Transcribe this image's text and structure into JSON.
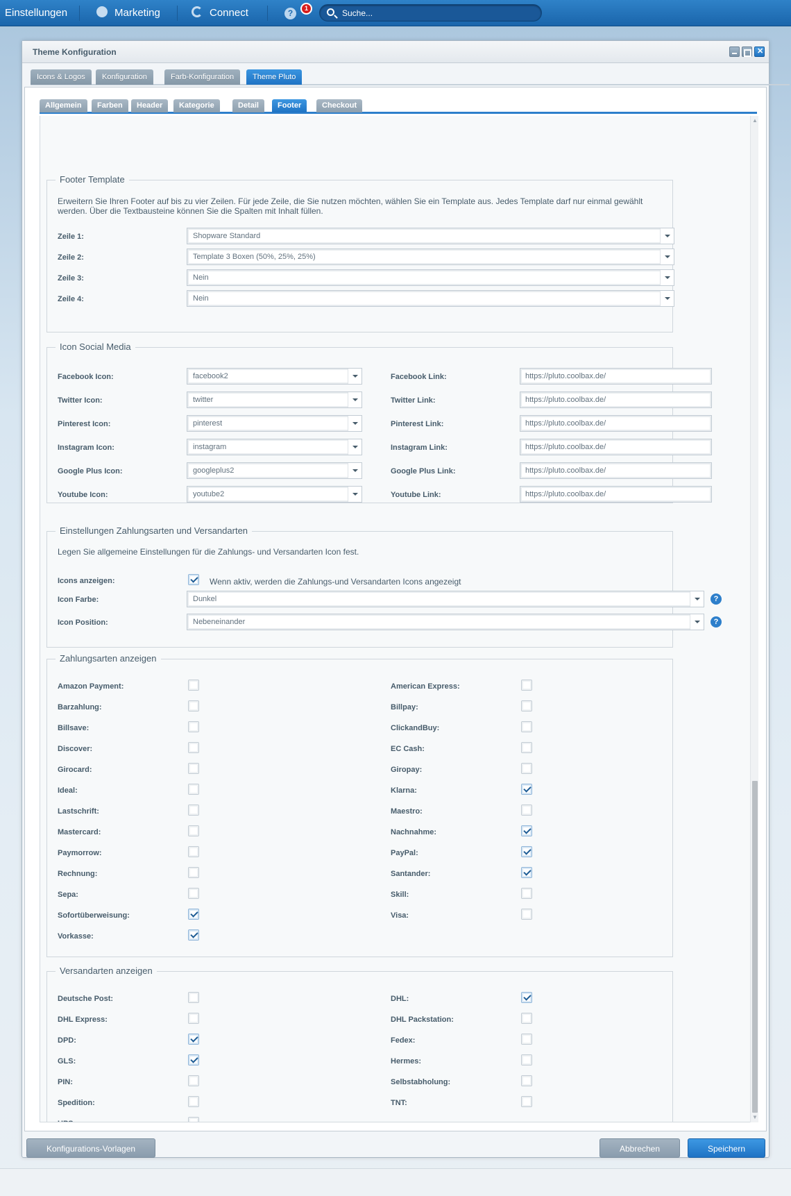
{
  "topbar": {
    "settings": "Einstellungen",
    "marketing": "Marketing",
    "connect": "Connect",
    "help": "?",
    "notifications": "1",
    "search_placeholder": "Suche..."
  },
  "window": {
    "title": "Theme Konfiguration",
    "main_tabs": [
      "Icons & Logos",
      "Konfiguration",
      "Farb-Konfiguration",
      "Theme Pluto"
    ],
    "active_main_tab": "Theme Pluto",
    "sub_tabs": [
      "Allgemein",
      "Farben",
      "Header",
      "Kategorie",
      "Detail",
      "Footer",
      "Checkout"
    ],
    "active_sub_tab": "Footer"
  },
  "footer_template": {
    "legend": "Footer Template",
    "description": "Erweitern Sie Ihren Footer auf bis zu vier Zeilen. Für jede Zeile, die Sie nutzen möchten, wählen Sie ein Template aus. Jedes Template darf nur einmal gewählt werden. Über die Textbausteine können Sie die Spalten mit Inhalt füllen.",
    "rows": [
      {
        "label": "Zeile 1:",
        "value": "Shopware Standard"
      },
      {
        "label": "Zeile 2:",
        "value": "Template 3 Boxen (50%, 25%, 25%)"
      },
      {
        "label": "Zeile 3:",
        "value": "Nein"
      },
      {
        "label": "Zeile 4:",
        "value": "Nein"
      }
    ]
  },
  "social": {
    "legend": "Icon Social Media",
    "rows": [
      {
        "icon_label": "Facebook Icon:",
        "icon_value": "facebook2",
        "link_label": "Facebook Link:",
        "link_value": "https://pluto.coolbax.de/"
      },
      {
        "icon_label": "Twitter Icon:",
        "icon_value": "twitter",
        "link_label": "Twitter Link:",
        "link_value": "https://pluto.coolbax.de/"
      },
      {
        "icon_label": "Pinterest Icon:",
        "icon_value": "pinterest",
        "link_label": "Pinterest Link:",
        "link_value": "https://pluto.coolbax.de/"
      },
      {
        "icon_label": "Instagram Icon:",
        "icon_value": "instagram",
        "link_label": "Instagram Link:",
        "link_value": "https://pluto.coolbax.de/"
      },
      {
        "icon_label": "Google Plus Icon:",
        "icon_value": "googleplus2",
        "link_label": "Google Plus Link:",
        "link_value": "https://pluto.coolbax.de/"
      },
      {
        "icon_label": "Youtube Icon:",
        "icon_value": "youtube2",
        "link_label": "Youtube Link:",
        "link_value": "https://pluto.coolbax.de/"
      }
    ]
  },
  "payment_settings": {
    "legend": "Einstellungen Zahlungsarten und Versandarten",
    "description": "Legen Sie allgemeine Einstellungen für die Zahlungs- und Versandarten Icon fest.",
    "icons_label": "Icons anzeigen:",
    "icons_checked": true,
    "icons_hint": "Wenn aktiv, werden die Zahlungs-und Versandarten Icons angezeigt",
    "color_label": "Icon Farbe:",
    "color_value": "Dunkel",
    "position_label": "Icon Position:",
    "position_value": "Nebeneinander"
  },
  "payments": {
    "legend": "Zahlungsarten anzeigen",
    "left": [
      {
        "label": "Amazon Payment:",
        "checked": false
      },
      {
        "label": "Barzahlung:",
        "checked": false
      },
      {
        "label": "Billsave:",
        "checked": false
      },
      {
        "label": "Discover:",
        "checked": false
      },
      {
        "label": "Girocard:",
        "checked": false
      },
      {
        "label": "Ideal:",
        "checked": false
      },
      {
        "label": "Lastschrift:",
        "checked": false
      },
      {
        "label": "Mastercard:",
        "checked": false
      },
      {
        "label": "Paymorrow:",
        "checked": false
      },
      {
        "label": "Rechnung:",
        "checked": false
      },
      {
        "label": "Sepa:",
        "checked": false
      },
      {
        "label": "Sofortüberweisung:",
        "checked": true
      },
      {
        "label": "Vorkasse:",
        "checked": true
      }
    ],
    "right": [
      {
        "label": "American Express:",
        "checked": false
      },
      {
        "label": "Billpay:",
        "checked": false
      },
      {
        "label": "ClickandBuy:",
        "checked": false
      },
      {
        "label": "EC Cash:",
        "checked": false
      },
      {
        "label": "Giropay:",
        "checked": false
      },
      {
        "label": "Klarna:",
        "checked": true
      },
      {
        "label": "Maestro:",
        "checked": false
      },
      {
        "label": "Nachnahme:",
        "checked": true
      },
      {
        "label": "PayPal:",
        "checked": true
      },
      {
        "label": "Santander:",
        "checked": true
      },
      {
        "label": "Skill:",
        "checked": false
      },
      {
        "label": "Visa:",
        "checked": false
      }
    ]
  },
  "shipping": {
    "legend": "Versandarten anzeigen",
    "left": [
      {
        "label": "Deutsche Post:",
        "checked": false
      },
      {
        "label": "DHL Express:",
        "checked": false
      },
      {
        "label": "DPD:",
        "checked": true
      },
      {
        "label": "GLS:",
        "checked": true
      },
      {
        "label": "PIN:",
        "checked": false
      },
      {
        "label": "Spedition:",
        "checked": false
      },
      {
        "label": "UPS:",
        "checked": false
      }
    ],
    "right": [
      {
        "label": "DHL:",
        "checked": true
      },
      {
        "label": "DHL Packstation:",
        "checked": false
      },
      {
        "label": "Fedex:",
        "checked": false
      },
      {
        "label": "Hermes:",
        "checked": false
      },
      {
        "label": "Selbstabholung:",
        "checked": false
      },
      {
        "label": "TNT:",
        "checked": false
      }
    ]
  },
  "buttons": {
    "vorlagen": "Konfigurations-Vorlagen",
    "cancel": "Abbrechen",
    "save": "Speichern"
  }
}
